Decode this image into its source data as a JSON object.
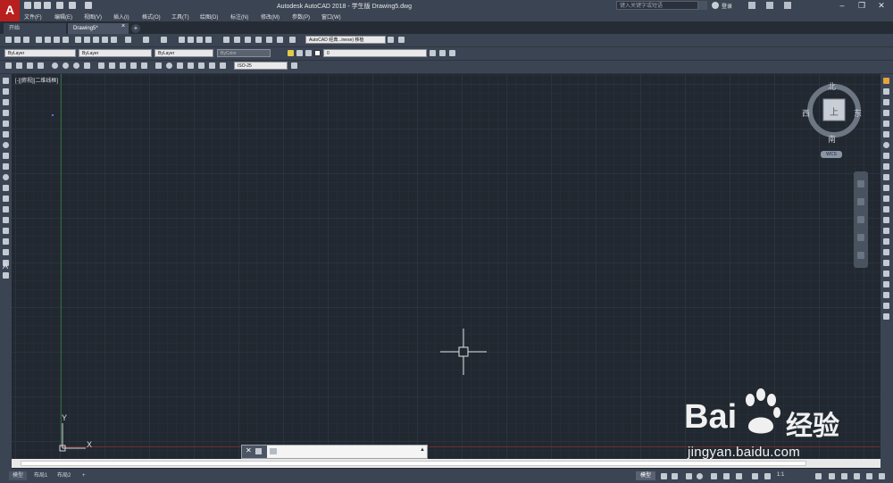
{
  "window": {
    "title": "Autodesk AutoCAD 2018 - 学生版    Drawing5.dwg",
    "search_placeholder": "键入关键字或短语",
    "login_label": "登录"
  },
  "app_logo": "A",
  "menu": [
    "文件(F)",
    "编辑(E)",
    "视图(V)",
    "插入(I)",
    "格式(O)",
    "工具(T)",
    "绘图(D)",
    "标注(N)",
    "修改(M)",
    "参数(P)",
    "窗口(W)"
  ],
  "tabs": {
    "start": "开始",
    "drawing": "Drawing5*",
    "add": "+"
  },
  "toolbar": {
    "workspace": "AutoCAD 经典...inese) 移植",
    "color": "ByLayer",
    "linetype": "ByLayer",
    "lineweight": "ByLayer",
    "plotstyle": "ByColor",
    "layer": "0",
    "dimstyle": "ISO-25"
  },
  "viewport": {
    "label": "[-][俯视][二维线框]"
  },
  "viewcube": {
    "north": "北",
    "south": "南",
    "east": "东",
    "west": "西",
    "face": "上",
    "wcs": "WCS"
  },
  "ucs": {
    "x": "X",
    "y": "Y"
  },
  "status": {
    "model": "模型",
    "layout_tabs": [
      "模型",
      "布局1",
      "布局2"
    ],
    "scale": "1:1"
  },
  "watermark": {
    "brand": "Bai",
    "brand2": "经验",
    "domain": "jingyan.baidu.com"
  },
  "colors": {
    "background": "#212830",
    "chrome": "#3b4453",
    "logo": "#b81f1f"
  }
}
